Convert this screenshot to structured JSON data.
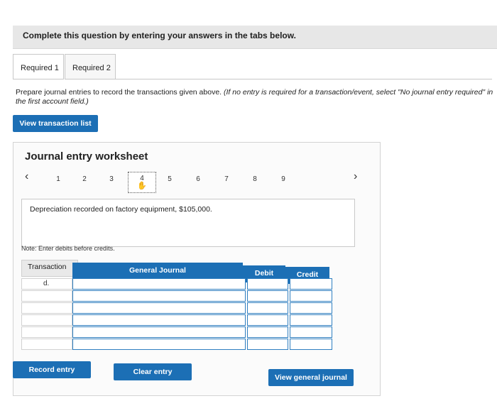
{
  "banner": {
    "text": "Complete this question by entering your answers in the tabs below."
  },
  "tabs": [
    {
      "label": "Required 1"
    },
    {
      "label": "Required 2"
    }
  ],
  "instructions": {
    "text": "Prepare journal entries to record the transactions given above.",
    "italic": "(If no entry is required for a transaction/event, select \"No journal entry required\" in the first account field.)"
  },
  "buttons": {
    "view_transaction_list": "View transaction list",
    "record_entry": "Record entry",
    "clear_entry": "Clear entry",
    "view_general_journal": "View general journal"
  },
  "worksheet": {
    "title": "Journal entry worksheet",
    "pages": [
      "1",
      "2",
      "3",
      "4",
      "5",
      "6",
      "7",
      "8",
      "9"
    ],
    "active_page": "4",
    "description": "Depreciation recorded on factory equipment, $105,000.",
    "note": "Note: Enter debits before credits."
  },
  "table": {
    "headers": {
      "transaction": "Transaction",
      "general_journal": "General Journal",
      "debit": "Debit",
      "credit": "Credit"
    },
    "rows": [
      {
        "transaction": "d."
      },
      {
        "transaction": ""
      },
      {
        "transaction": ""
      },
      {
        "transaction": ""
      },
      {
        "transaction": ""
      },
      {
        "transaction": ""
      }
    ]
  },
  "icons": {
    "prev": "chevron-left-icon",
    "next": "chevron-right-icon",
    "pointer": "hand-pointer-icon"
  },
  "colors": {
    "accent": "#1c6fb5",
    "grid": "#2f7fc1"
  }
}
